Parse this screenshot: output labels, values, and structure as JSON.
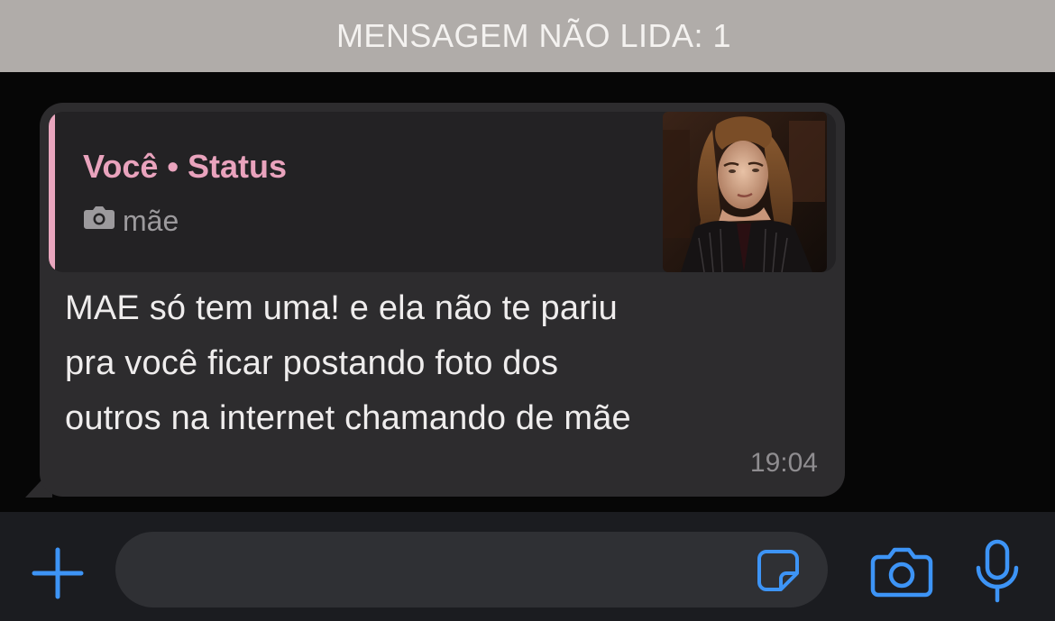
{
  "banner": {
    "text": "MENSAGEM NÃO LIDA: 1"
  },
  "message": {
    "quote": {
      "author": "Você • Status",
      "caption": "mãe",
      "caption_icon": "camera-icon",
      "accent_color": "#e9a3bd",
      "thumbnail": "photo-thumbnail"
    },
    "lines": [
      "MAE só tem uma! e ela não te pariu",
      "pra você ficar postando foto dos",
      "outros na internet chamando de mãe"
    ],
    "time": "19:04"
  },
  "composer": {
    "input_value": "",
    "placeholder": "",
    "icons": {
      "add": "plus-icon",
      "sticker": "sticker-icon",
      "camera": "camera-icon",
      "mic": "microphone-icon"
    },
    "accent_color": "#3d94f6"
  }
}
